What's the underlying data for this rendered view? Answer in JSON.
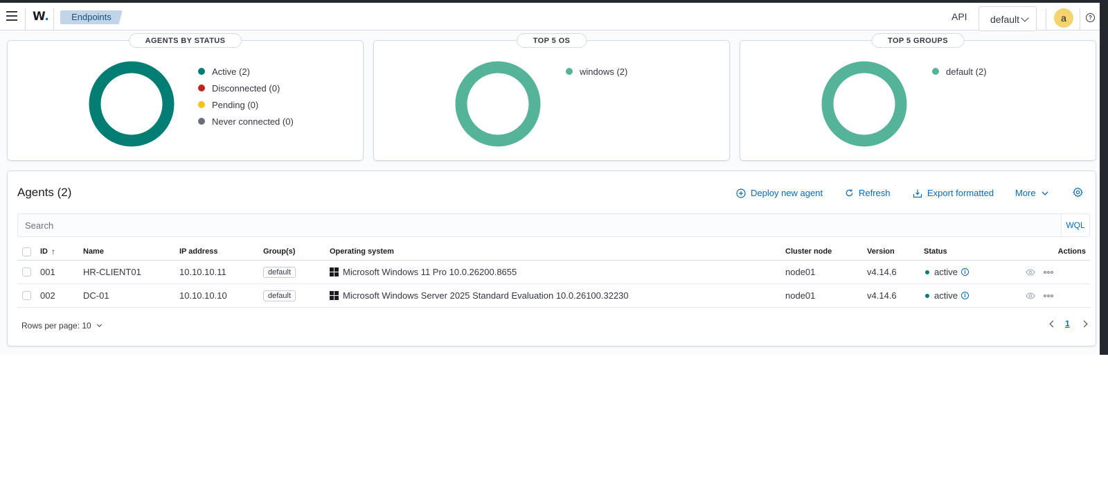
{
  "header": {
    "logo_text": "W",
    "logo_dot": ".",
    "breadcrumb": "Endpoints",
    "api_label": "API",
    "api_selected": "default",
    "avatar_letter": "a",
    "help_glyph": "?"
  },
  "cards": {
    "status": {
      "title": "AGENTS BY STATUS",
      "legend": [
        "Active (2)",
        "Disconnected (0)",
        "Pending (0)",
        "Never connected (0)"
      ]
    },
    "os": {
      "title": "TOP 5 OS",
      "legend": [
        "windows (2)"
      ]
    },
    "groups": {
      "title": "TOP 5 GROUPS",
      "legend": [
        "default (2)"
      ]
    }
  },
  "chart_data": [
    {
      "type": "pie",
      "title": "AGENTS BY STATUS",
      "categories": [
        "Active",
        "Disconnected",
        "Pending",
        "Never connected"
      ],
      "values": [
        2,
        0,
        0,
        0
      ],
      "colors": [
        "#017d73",
        "#bd271e",
        "#f5c021",
        "#69707d"
      ]
    },
    {
      "type": "pie",
      "title": "TOP 5 OS",
      "categories": [
        "windows"
      ],
      "values": [
        2
      ],
      "colors": [
        "#54b399"
      ]
    },
    {
      "type": "pie",
      "title": "TOP 5 GROUPS",
      "categories": [
        "default"
      ],
      "values": [
        2
      ],
      "colors": [
        "#54b399"
      ]
    }
  ],
  "agents": {
    "title": "Agents (2)",
    "toolbar": {
      "deploy": "Deploy new agent",
      "refresh": "Refresh",
      "export": "Export formatted",
      "more": "More"
    },
    "search_placeholder": "Search",
    "wql": "WQL",
    "columns": [
      "ID",
      "Name",
      "IP address",
      "Group(s)",
      "Operating system",
      "Cluster node",
      "Version",
      "Status",
      "Actions"
    ],
    "sort_indicator": "↑",
    "rows": [
      {
        "id": "001",
        "name": "HR-CLIENT01",
        "ip": "10.10.10.11",
        "group": "default",
        "os": "Microsoft Windows 11 Pro 10.0.26200.8655",
        "node": "node01",
        "version": "v4.14.6",
        "status": "active"
      },
      {
        "id": "002",
        "name": "DC-01",
        "ip": "10.10.10.10",
        "group": "default",
        "os": "Microsoft Windows Server 2025 Standard Evaluation 10.0.26100.32230",
        "node": "node01",
        "version": "v4.14.6",
        "status": "active"
      }
    ],
    "rows_per_page": "Rows per page: 10",
    "current_page": "1"
  },
  "colors": {
    "accent": "#006bb8",
    "active": "#017d73",
    "disconnected": "#bd271e",
    "pending": "#f5c021",
    "never": "#69707d",
    "chart_green": "#54b399"
  }
}
